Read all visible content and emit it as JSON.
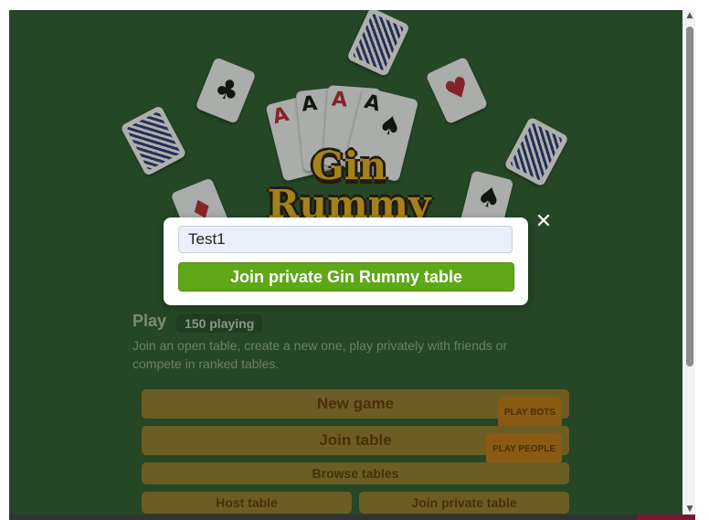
{
  "logo": {
    "line1": "Gin",
    "line2": "Rummy"
  },
  "cards": {
    "hand_ranks": [
      "A",
      "A",
      "A",
      "A"
    ],
    "spade": "♠",
    "club": "♣",
    "heart": "♥",
    "diamond": "♦"
  },
  "play": {
    "title": "Play",
    "count": "150 playing",
    "description": "Join an open table, create a new one, play privately with friends or compete in ranked tables.",
    "new_game_label": "New game",
    "new_game_pill": "PLAY BOTS",
    "join_table_label": "Join table",
    "join_table_pill": "PLAY PEOPLE",
    "browse_label": "Browse tables",
    "host_label": "Host table",
    "join_private_label": "Join private table"
  },
  "modal": {
    "input_value": "Test1",
    "join_button": "Join private Gin Rummy table",
    "close": "✕"
  },
  "colors": {
    "background": "#2e5e30",
    "join_button": "#5ea817",
    "logo": "#f2b820"
  },
  "scrollbar": {
    "up": "▲",
    "down": "▼"
  }
}
